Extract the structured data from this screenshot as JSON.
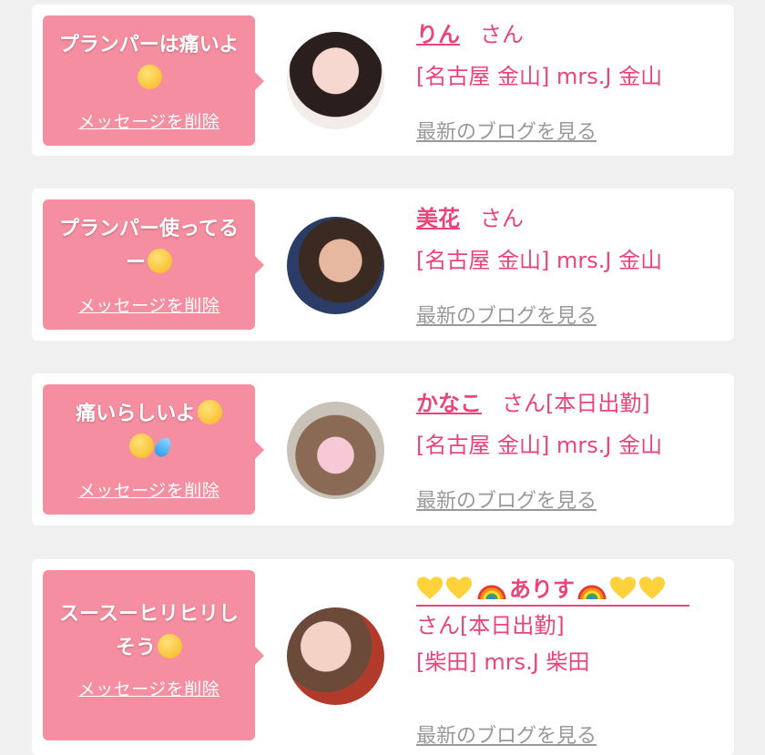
{
  "cards": [
    {
      "message_text": "プランパーは痛いよ",
      "delete_label": "メッセージを削除",
      "name": "りん",
      "suffix": "さん",
      "status": "",
      "shop": "[名古屋 金山] mrs.J 金山",
      "blog_link": "最新のブログを見る",
      "avatar_icon": "avatar-photo"
    },
    {
      "message_text": "プランパー使ってるー",
      "delete_label": "メッセージを削除",
      "name": "美花",
      "suffix": "さん",
      "status": "",
      "shop": "[名古屋 金山] mrs.J 金山",
      "blog_link": "最新のブログを見る",
      "avatar_icon": "avatar-photo"
    },
    {
      "message_text": "痛いらしいよ",
      "delete_label": "メッセージを削除",
      "name": "かなこ",
      "suffix": "さん",
      "status": "[本日出勤]",
      "shop": "[名古屋 金山] mrs.J 金山",
      "blog_link": "最新のブログを見る",
      "avatar_icon": "avatar-photo"
    },
    {
      "message_text": "スースーヒリヒリしそう",
      "delete_label": "メッセージを削除",
      "name": "ありす",
      "suffix": "さん",
      "status": "[本日出勤]",
      "shop": "[柴田] mrs.J 柴田",
      "blog_link": "最新のブログを見る",
      "avatar_icon": "avatar-photo"
    }
  ],
  "colors": {
    "page_bg": "#f0f0f0",
    "bubble": "#f58ea0",
    "accent": "#e8457a",
    "muted_link": "#999999"
  }
}
